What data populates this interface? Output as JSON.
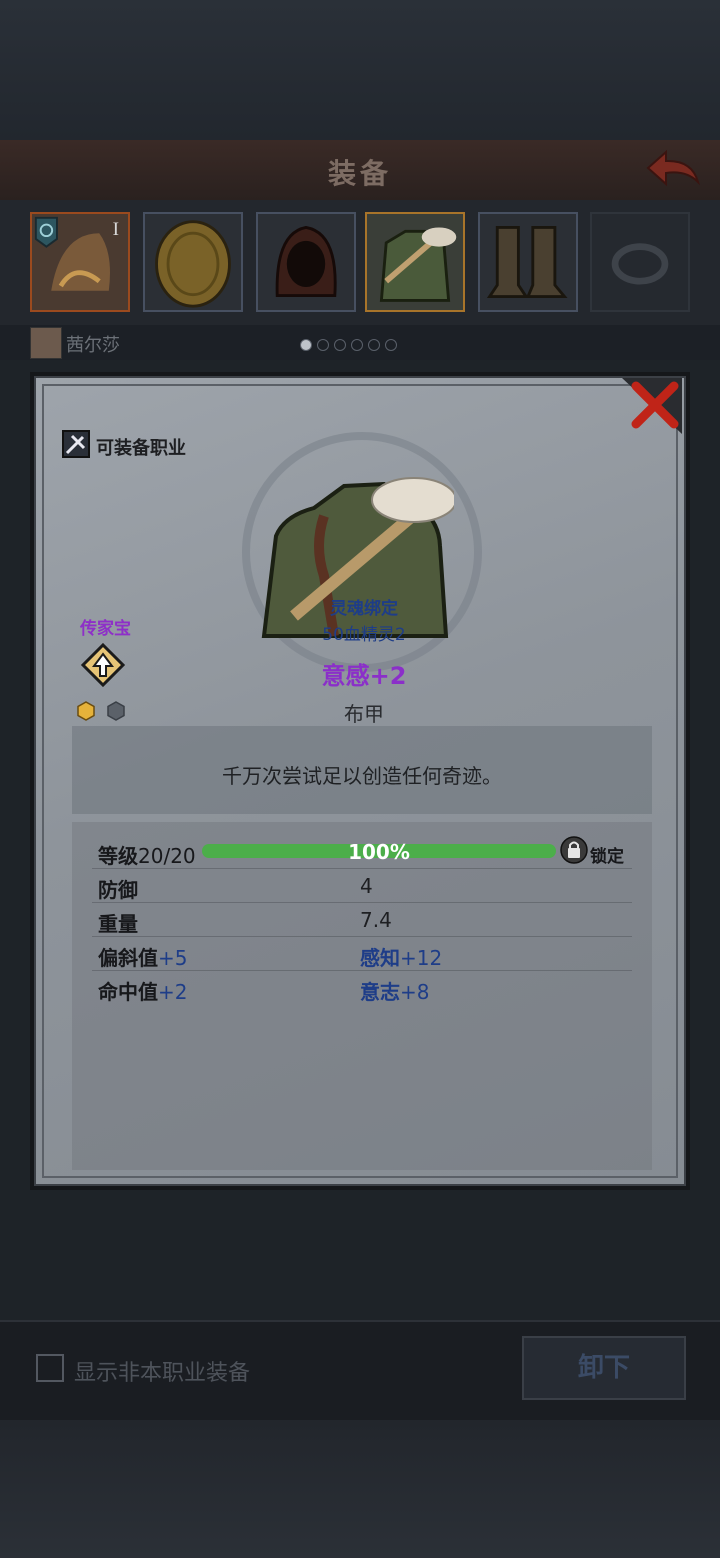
{
  "header": {
    "title": "装备"
  },
  "character": {
    "name": "茜尔莎",
    "page_count": 6,
    "current_page": 1
  },
  "equipment_slots": [
    {
      "name": "helmet",
      "rank": "I"
    },
    {
      "name": "shield"
    },
    {
      "name": "hood"
    },
    {
      "name": "armor",
      "selected": true
    },
    {
      "name": "boots"
    },
    {
      "name": "ring"
    }
  ],
  "item": {
    "class_label": "可装备职业",
    "heirloom_label": "传家宝",
    "soulbind_title": "灵魂绑定",
    "soulbind_sub": "50血精灵2",
    "bonus": "意感+2",
    "type": "布甲",
    "flavor": "千万次尝试足以创造任何奇迹。",
    "level_label": "等级",
    "level_value": "20/20",
    "progress_text": "100%",
    "progress": 1.0,
    "lock_label": "锁定",
    "stats": [
      {
        "name": "防御",
        "value": "4"
      },
      {
        "name": "重量",
        "value": "7.4"
      }
    ],
    "attr_rows": [
      {
        "left_name": "偏斜值",
        "left_val": "+5",
        "right_name": "感知",
        "right_val": "+12"
      },
      {
        "left_name": "命中值",
        "left_val": "+2",
        "right_name": "意志",
        "right_val": "+8"
      }
    ]
  },
  "footer": {
    "show_non_class_label": "显示非本职业装备",
    "unequip_label": "卸下"
  },
  "colors": {
    "heirloom": "#8e2fc8",
    "blue_text": "#1e3d88",
    "progress_fill": "#4cae4a"
  }
}
